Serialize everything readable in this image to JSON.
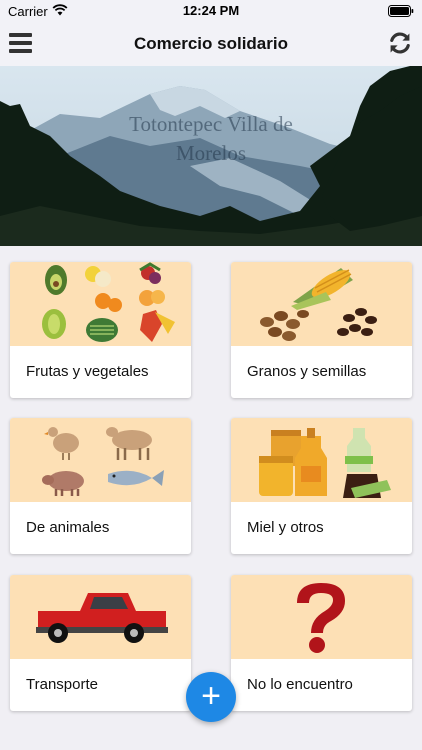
{
  "status_bar": {
    "carrier": "Carrier",
    "time": "12:24 PM"
  },
  "nav": {
    "title": "Comercio solidario",
    "menu_icon": "hamburger-menu-icon",
    "refresh_icon": "refresh-icon"
  },
  "hero": {
    "title": "Totontepec Villa de Morelos"
  },
  "categories": [
    {
      "label": "Frutas y vegetales",
      "icon": "fruits-vegetables-illustration"
    },
    {
      "label": "Granos y semillas",
      "icon": "grains-seeds-illustration"
    },
    {
      "label": "De animales",
      "icon": "animals-illustration"
    },
    {
      "label": "Miel y otros",
      "icon": "honey-jars-illustration"
    },
    {
      "label": "Transporte",
      "icon": "pickup-truck-illustration"
    },
    {
      "label": "No lo encuentro",
      "icon": "question-mark-illustration"
    }
  ],
  "fab": {
    "label": "+"
  },
  "colors": {
    "accent": "#1e88e5",
    "card_image_bg": "#fde0b5",
    "page_bg": "#f0eff4"
  }
}
